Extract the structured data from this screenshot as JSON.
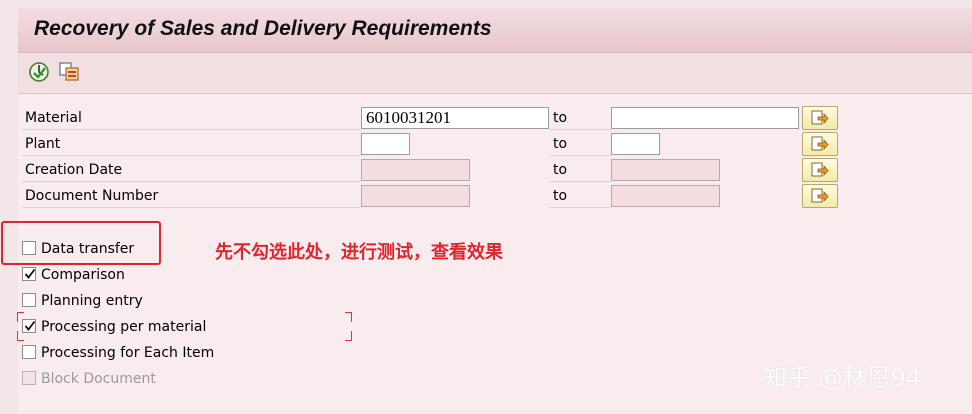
{
  "window": {
    "title": "Recovery of Sales and Delivery Requirements"
  },
  "toolbar": {
    "execute_icon": "execute-icon",
    "variants_icon": "copy-variant-icon"
  },
  "selection": {
    "rows": [
      {
        "label": "Material",
        "from": "6010031201",
        "to_label": "to",
        "to": ""
      },
      {
        "label": "Plant",
        "from": "",
        "to_label": "to",
        "to": ""
      },
      {
        "label": "Creation Date",
        "from": "",
        "to_label": "to",
        "to": ""
      },
      {
        "label": "Document Number",
        "from": "",
        "to_label": "to",
        "to": ""
      }
    ]
  },
  "options": [
    {
      "label": "Data transfer",
      "checked": false,
      "disabled": false
    },
    {
      "label": "Comparison",
      "checked": true,
      "disabled": false
    },
    {
      "label": "Planning entry",
      "checked": false,
      "disabled": false
    },
    {
      "label": "Processing per material",
      "checked": true,
      "disabled": false
    },
    {
      "label": "Processing for Each Item",
      "checked": false,
      "disabled": false
    },
    {
      "label": "Block Document",
      "checked": false,
      "disabled": true
    }
  ],
  "annotation": {
    "text": "先不勾选此处，进行测试，查看效果",
    "color": "#e0262d"
  },
  "watermark": {
    "text": "知乎 @林恩94"
  },
  "colors": {
    "background": "#f4e6e8",
    "button": "#f3e9a8",
    "disabled_field": "#f3dde0"
  }
}
